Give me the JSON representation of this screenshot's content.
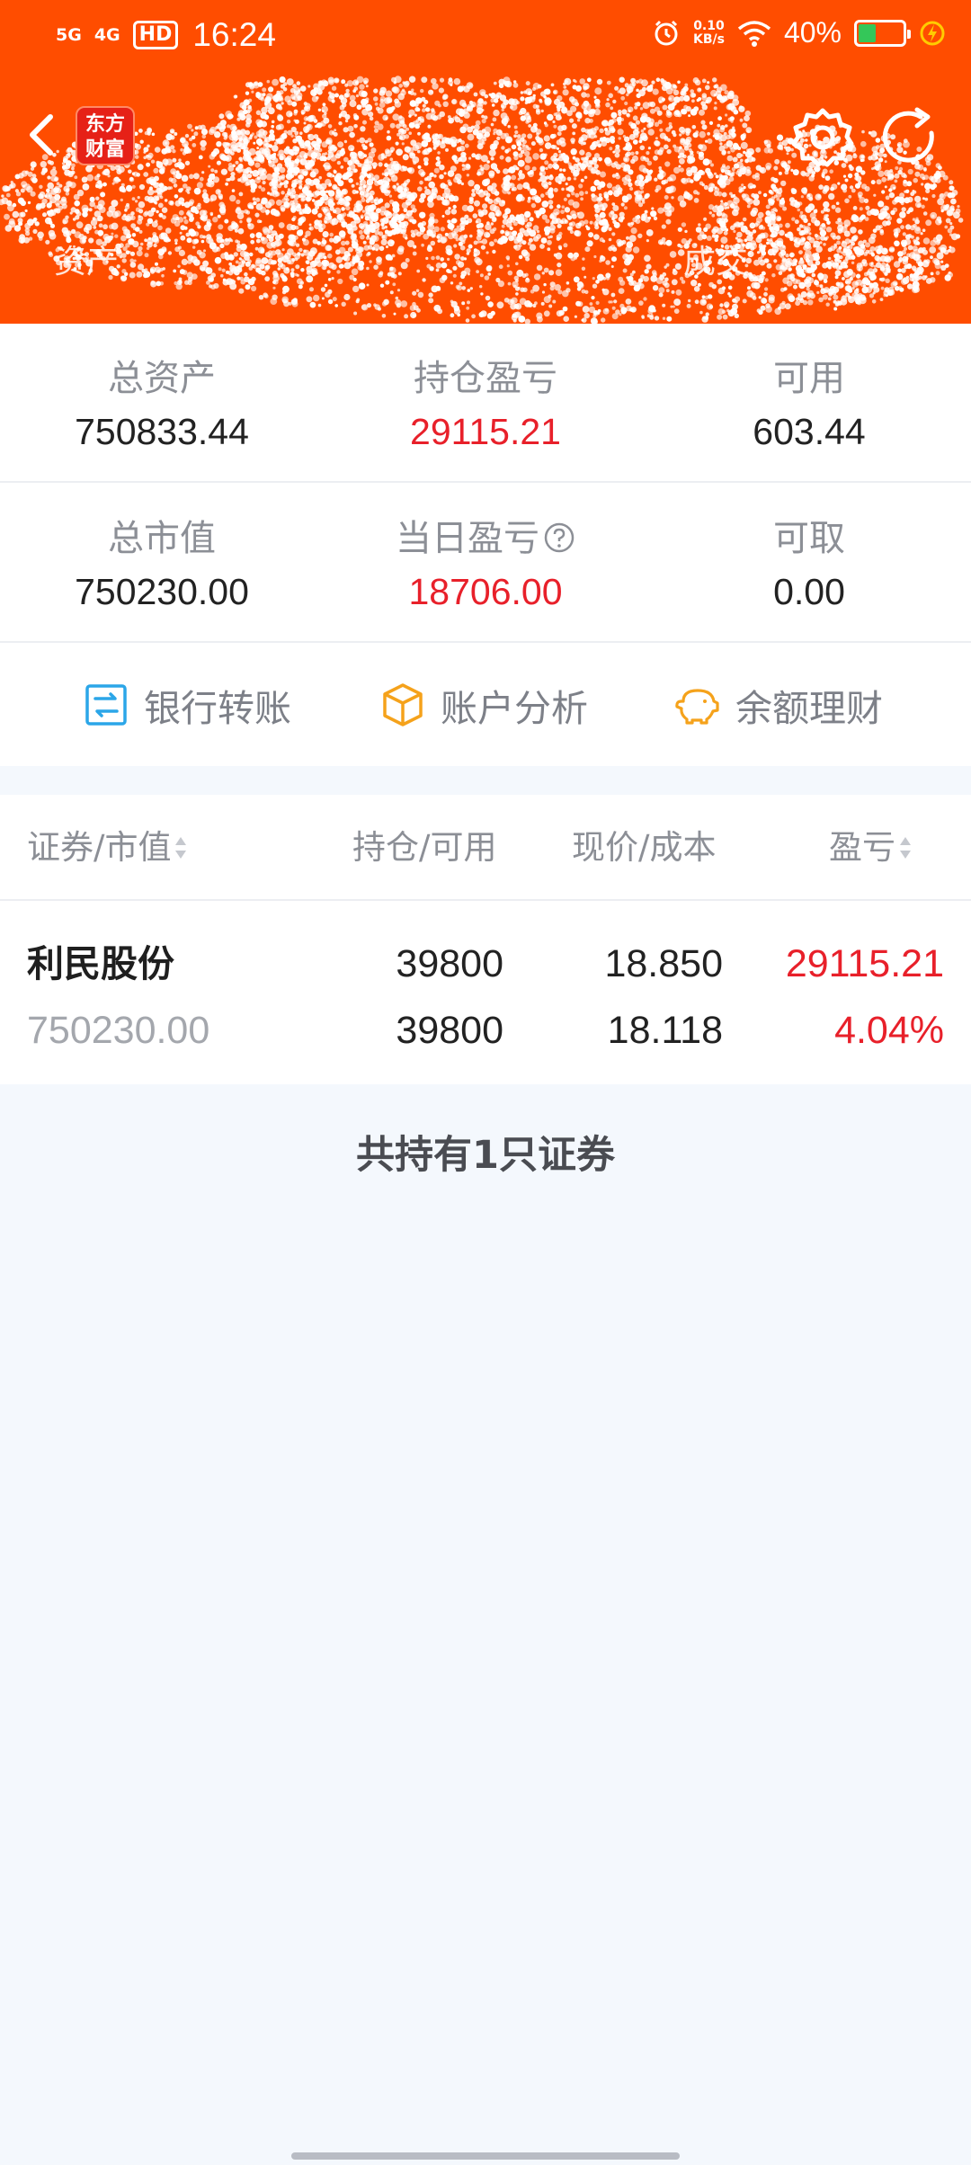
{
  "status_bar": {
    "signal_1": "5G",
    "signal_2": "4G",
    "hd_badge": "HD",
    "time": "16:24",
    "net_speed_value": "0.10",
    "net_speed_unit": "KB/s",
    "battery_pct": "40%",
    "battery_level": 0.4
  },
  "header": {
    "logo_line1": "东方",
    "logo_line2": "财富",
    "tab_left": "资产",
    "tab_right": "成交",
    "bg_color": "#ff4d00"
  },
  "summary": {
    "total_assets": {
      "label": "总资产",
      "value": "750833.44"
    },
    "position_pl": {
      "label": "持仓盈亏",
      "value": "29115.21"
    },
    "available": {
      "label": "可用",
      "value": "603.44"
    },
    "market_value": {
      "label": "总市值",
      "value": "750230.00"
    },
    "daily_pl": {
      "label": "当日盈亏",
      "value": "18706.00"
    },
    "withdrawable": {
      "label": "可取",
      "value": "0.00"
    }
  },
  "actions": {
    "bank_transfer": "银行转账",
    "account_analysis": "账户分析",
    "balance_finance": "余额理财"
  },
  "holdings_header": {
    "col1": "证券/市值",
    "col2": "持仓/可用",
    "col3": "现价/成本",
    "col4": "盈亏"
  },
  "holdings": [
    {
      "name": "利民股份",
      "market_value": "750230.00",
      "position": "39800",
      "available": "39800",
      "price": "18.850",
      "cost": "18.118",
      "pl": "29115.21",
      "pl_pct": "4.04%"
    }
  ],
  "footer_note": "共持有1只证券",
  "colors": {
    "accent": "#ff4d00",
    "gain": "#e8202a",
    "muted": "#8c8f96"
  }
}
